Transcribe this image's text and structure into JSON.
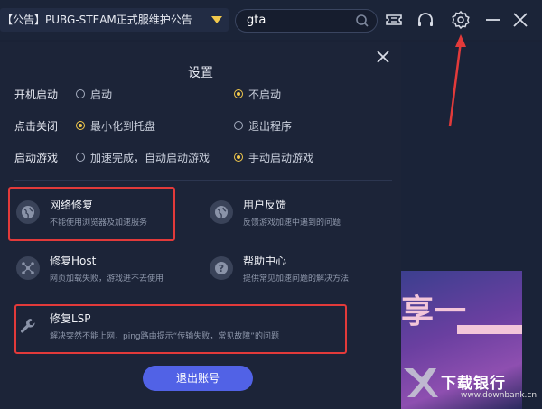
{
  "topbar": {
    "notice": "【公告】PUBG-STEAM正式服维护公告",
    "search_value": "gta"
  },
  "settings": {
    "title": "设置",
    "rows": [
      {
        "label": "开机启动",
        "options": [
          {
            "text": "启动",
            "selected": false
          },
          {
            "text": "不启动",
            "selected": true
          }
        ]
      },
      {
        "label": "点击关闭",
        "options": [
          {
            "text": "最小化到托盘",
            "selected": true
          },
          {
            "text": "退出程序",
            "selected": false
          }
        ]
      },
      {
        "label": "启动游戏",
        "options": [
          {
            "text": "加速完成，自动启动游戏",
            "selected": false
          },
          {
            "text": "手动启动游戏",
            "selected": true
          }
        ]
      }
    ],
    "tools": [
      {
        "name": "网络修复",
        "desc": "不能使用浏览器及加速服务",
        "icon": "globe-icon"
      },
      {
        "name": "用户反馈",
        "desc": "反馈游戏加速中遇到的问题",
        "icon": "globe-icon"
      },
      {
        "name": "修复Host",
        "desc": "网页加载失败，游戏进不去使用",
        "icon": "network-icon"
      },
      {
        "name": "帮助中心",
        "desc": "提供常见加速问题的解决方法",
        "icon": "question-icon"
      },
      {
        "name": "修复LSP",
        "desc": "解决突然不能上网，ping路由提示“传输失败，常见故障”的问题",
        "icon": "wrench-icon"
      }
    ],
    "logout_label": "退出账号"
  },
  "background": {
    "art_text": "享一",
    "watermark": "下载银行",
    "watermark_sub": "www.downbank.cn"
  },
  "colors": {
    "accent": "#f2c94c",
    "button": "#5162e6",
    "highlight": "#e23a3a"
  }
}
